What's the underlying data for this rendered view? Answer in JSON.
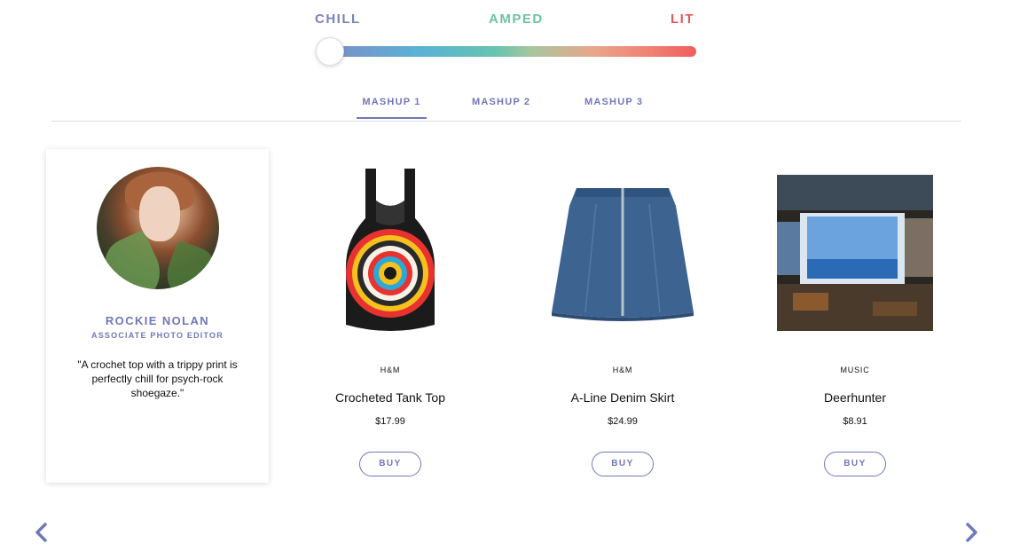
{
  "mood_slider": {
    "labels": {
      "chill": "CHILL",
      "amped": "AMPED",
      "lit": "LIT"
    },
    "value": 0,
    "colors": {
      "chill": "#7b82bd",
      "amped": "#6cc4a1",
      "lit": "#e8585a"
    }
  },
  "tabs": [
    {
      "label": "MASHUP 1",
      "active": true
    },
    {
      "label": "MASHUP 2",
      "active": false
    },
    {
      "label": "MASHUP 3",
      "active": false
    }
  ],
  "editor": {
    "name": "ROCKIE NOLAN",
    "role": "ASSOCIATE PHOTO EDITOR",
    "quote": "\"A crochet top with a trippy print is perfectly chill for psych-rock shoegaze.\""
  },
  "products": [
    {
      "brand": "H&M",
      "name": "Crocheted Tank Top",
      "price": "$17.99",
      "button": "BUY",
      "image_icon": "crochet-tank-top-image"
    },
    {
      "brand": "H&M",
      "name": "A-Line Denim Skirt",
      "price": "$24.99",
      "button": "BUY",
      "image_icon": "denim-skirt-image"
    },
    {
      "brand": "MUSIC",
      "name": "Deerhunter",
      "price": "$8.91",
      "button": "BUY",
      "image_icon": "album-cover-image"
    }
  ],
  "navigation": {
    "prev_icon": "chevron-left-icon",
    "next_icon": "chevron-right-icon"
  },
  "accent_color": "#7078b8"
}
